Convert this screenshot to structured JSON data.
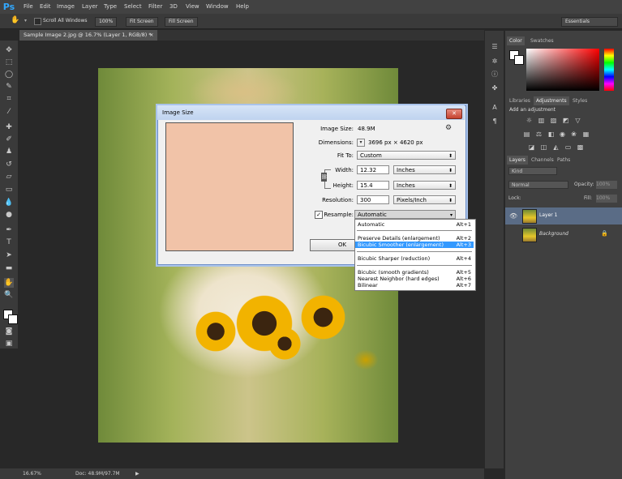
{
  "app": {
    "logo": "Ps"
  },
  "menu": [
    "File",
    "Edit",
    "Image",
    "Layer",
    "Type",
    "Select",
    "Filter",
    "3D",
    "View",
    "Window",
    "Help"
  ],
  "options_bar": {
    "tool_icon": "hand-icon",
    "scroll_all_windows": "Scroll All Windows",
    "zoom_100": "100%",
    "fit_screen": "Fit Screen",
    "fill_screen": "Fill Screen",
    "workspace": "Essentials"
  },
  "document": {
    "tab_title": "Sample Image 2.jpg @ 16.7% (Layer 1, RGB/8) *",
    "tab_close": "×"
  },
  "status_bar": {
    "zoom": "16.67%",
    "doc": "Doc: 48.9M/97.7M"
  },
  "dialog": {
    "title": "Image Size",
    "close": "✕",
    "image_size_label": "Image Size:",
    "image_size_value": "48.9M",
    "dimensions_label": "Dimensions:",
    "dimensions_value": "3696 px  ×  4620 px",
    "fit_to_label": "Fit To:",
    "fit_to_value": "Custom",
    "width_label": "Width:",
    "width_value": "12.32",
    "width_unit": "Inches",
    "height_label": "Height:",
    "height_value": "15.4",
    "height_unit": "Inches",
    "resolution_label": "Resolution:",
    "resolution_value": "300",
    "resolution_unit": "Pixels/Inch",
    "resample_label": "Resample:",
    "resample_checked": true,
    "resample_value": "Automatic",
    "ok": "OK"
  },
  "resample_menu": [
    {
      "label": "Automatic",
      "shortcut": "Alt+1"
    },
    {
      "label": "Preserve Details (enlargement)",
      "shortcut": "Alt+2"
    },
    {
      "label": "Bicubic Smoother (enlargement)",
      "shortcut": "Alt+3",
      "selected": true
    },
    {
      "label": "Bicubic Sharper (reduction)",
      "shortcut": "Alt+4"
    },
    {
      "label": "Bicubic (smooth gradients)",
      "shortcut": "Alt+5"
    },
    {
      "label": "Nearest Neighbor (hard edges)",
      "shortcut": "Alt+6"
    },
    {
      "label": "Bilinear",
      "shortcut": "Alt+7"
    }
  ],
  "panels": {
    "color_tabs": [
      "Color",
      "Swatches"
    ],
    "adjust_tabs": [
      "Libraries",
      "Adjustments",
      "Styles"
    ],
    "add_adjustment": "Add an adjustment",
    "layer_tabs": [
      "Layers",
      "Channels",
      "Paths"
    ],
    "kind": "Kind",
    "blend_mode": "Normal",
    "opacity_label": "Opacity:",
    "opacity_value": "100%",
    "lock_label": "Lock:",
    "fill_label": "Fill:",
    "fill_value": "100%",
    "layers": [
      {
        "name": "Layer 1",
        "active": true
      },
      {
        "name": "Background",
        "active": false
      }
    ]
  }
}
